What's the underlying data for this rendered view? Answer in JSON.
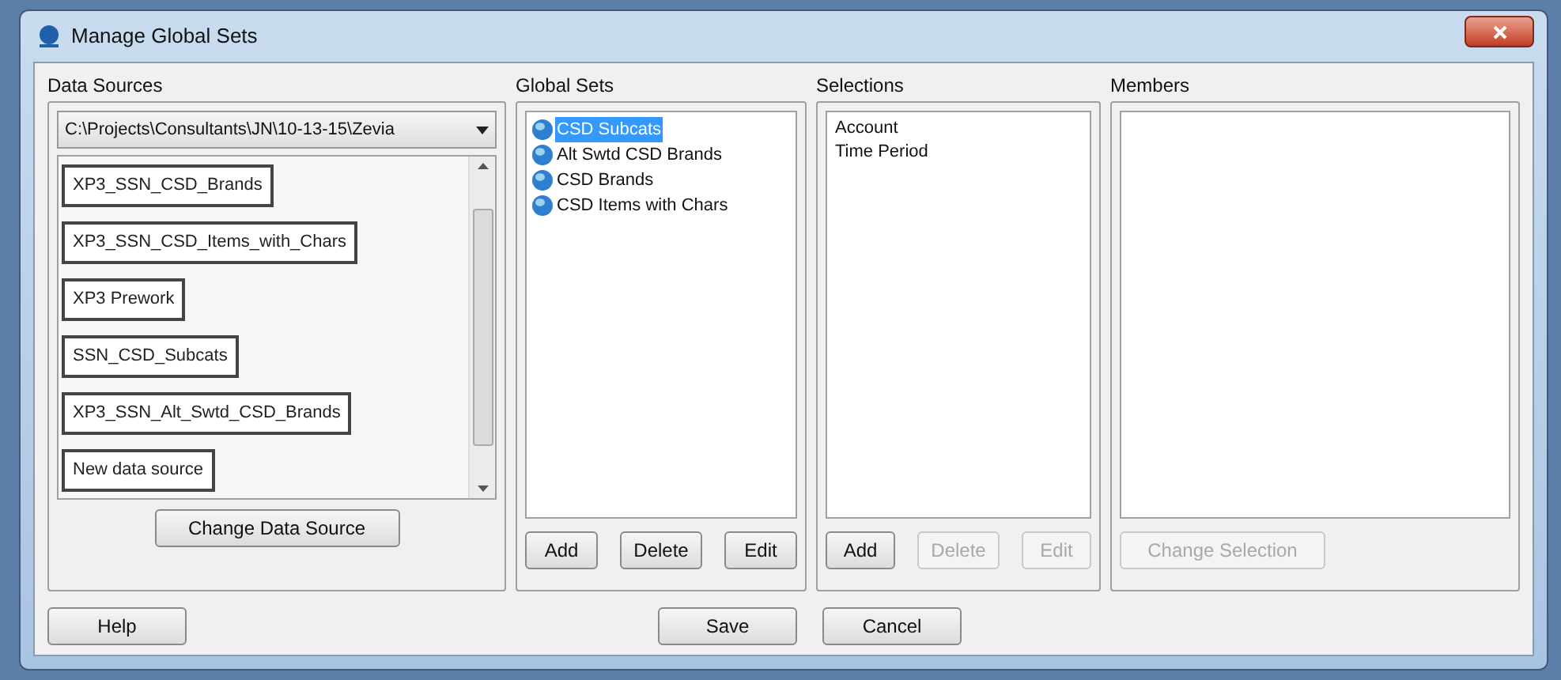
{
  "window": {
    "title": "Manage Global Sets"
  },
  "data_sources": {
    "heading": "Data Sources",
    "path": "C:\\Projects\\Consultants\\JN\\10-13-15\\Zevia",
    "items": [
      {
        "label": "XP3_SSN_CSD_Brands"
      },
      {
        "label": "XP3_SSN_CSD_Items_with_Chars"
      },
      {
        "label": "XP3 Prework"
      },
      {
        "label": "SSN_CSD_Subcats"
      },
      {
        "label": "XP3_SSN_Alt_Swtd_CSD_Brands"
      },
      {
        "label": "New data source"
      }
    ],
    "button": {
      "label": "Change Data Source",
      "disabled": false
    }
  },
  "global_sets": {
    "heading": "Global Sets",
    "items": [
      {
        "label": "CSD Subcats",
        "selected": true
      },
      {
        "label": "Alt Swtd CSD Brands",
        "selected": false
      },
      {
        "label": "CSD Brands",
        "selected": false
      },
      {
        "label": "CSD Items with Chars",
        "selected": false
      }
    ],
    "buttons": [
      {
        "label": "Add",
        "disabled": false
      },
      {
        "label": "Delete",
        "disabled": false
      },
      {
        "label": "Edit",
        "disabled": false
      }
    ]
  },
  "selections": {
    "heading": "Selections",
    "items": [
      "Account",
      "Time Period"
    ],
    "buttons": [
      {
        "label": "Add",
        "disabled": false
      },
      {
        "label": "Delete",
        "disabled": true
      },
      {
        "label": "Edit",
        "disabled": true
      }
    ]
  },
  "members": {
    "heading": "Members",
    "button": {
      "label": "Change Selection",
      "disabled": true
    }
  },
  "footer": {
    "buttons": [
      {
        "label": "Help",
        "disabled": false
      },
      {
        "label": "Save",
        "disabled": false
      },
      {
        "label": "Cancel",
        "disabled": false
      }
    ]
  }
}
